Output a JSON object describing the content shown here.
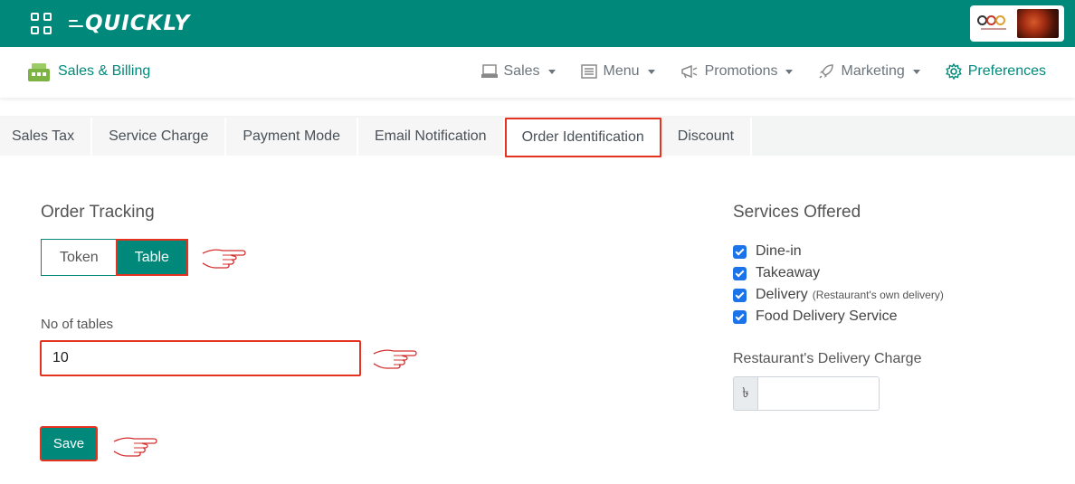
{
  "header": {
    "logo_text": "QUICKLY"
  },
  "navbar": {
    "app_title": "Sales & Billing",
    "menu": [
      {
        "label": "Sales",
        "icon": "register-icon",
        "dropdown": true
      },
      {
        "label": "Menu",
        "icon": "list-icon",
        "dropdown": true
      },
      {
        "label": "Promotions",
        "icon": "megaphone-icon",
        "dropdown": true
      },
      {
        "label": "Marketing",
        "icon": "rocket-icon",
        "dropdown": true
      },
      {
        "label": "Preferences",
        "icon": "gear-icon",
        "dropdown": false,
        "active": true
      }
    ]
  },
  "tabs": [
    {
      "label": "Sales Tax"
    },
    {
      "label": "Service Charge"
    },
    {
      "label": "Payment Mode"
    },
    {
      "label": "Email Notification"
    },
    {
      "label": "Order Identification",
      "active": true
    },
    {
      "label": "Discount"
    }
  ],
  "order_tracking": {
    "title": "Order Tracking",
    "options": [
      "Token",
      "Table"
    ],
    "selected": "Table",
    "tables_label": "No of tables",
    "tables_value": "10",
    "save_label": "Save"
  },
  "services": {
    "title": "Services Offered",
    "items": [
      {
        "label": "Dine-in",
        "note": "",
        "checked": true
      },
      {
        "label": "Takeaway",
        "note": "",
        "checked": true
      },
      {
        "label": "Delivery",
        "note": "(Restaurant's own delivery)",
        "checked": true
      },
      {
        "label": "Food Delivery Service",
        "note": "",
        "checked": true
      }
    ],
    "delivery_charge_label": "Restaurant's Delivery Charge",
    "currency_symbol": "৳",
    "delivery_charge_value": ""
  },
  "colors": {
    "brand": "#00897b",
    "highlight": "#e53322",
    "checkbox": "#1a73e8"
  }
}
